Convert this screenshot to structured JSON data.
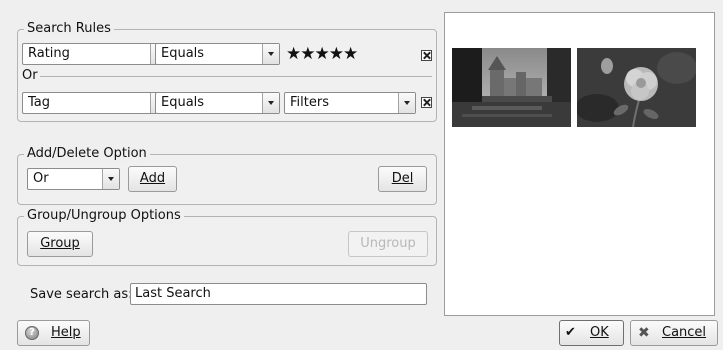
{
  "search_rules": {
    "title": "Search Rules",
    "rule1": {
      "field": "Rating",
      "operator": "Equals",
      "value_stars": "★★★★★"
    },
    "or_label": "Or",
    "rule2": {
      "field": "Tag",
      "operator": "Equals",
      "value": "Filters"
    }
  },
  "add_delete": {
    "title": "Add/Delete Option",
    "combo_value": "Or",
    "add_label": "Add",
    "del_label": "Del"
  },
  "group_ungroup": {
    "title": "Group/Ungroup Options",
    "group_label": "Group",
    "ungroup_label": "Ungroup"
  },
  "save": {
    "label": "Save search as:",
    "value": "Last Search"
  },
  "footer": {
    "help_label": "Help",
    "ok_label": "OK",
    "cancel_label": "Cancel"
  }
}
